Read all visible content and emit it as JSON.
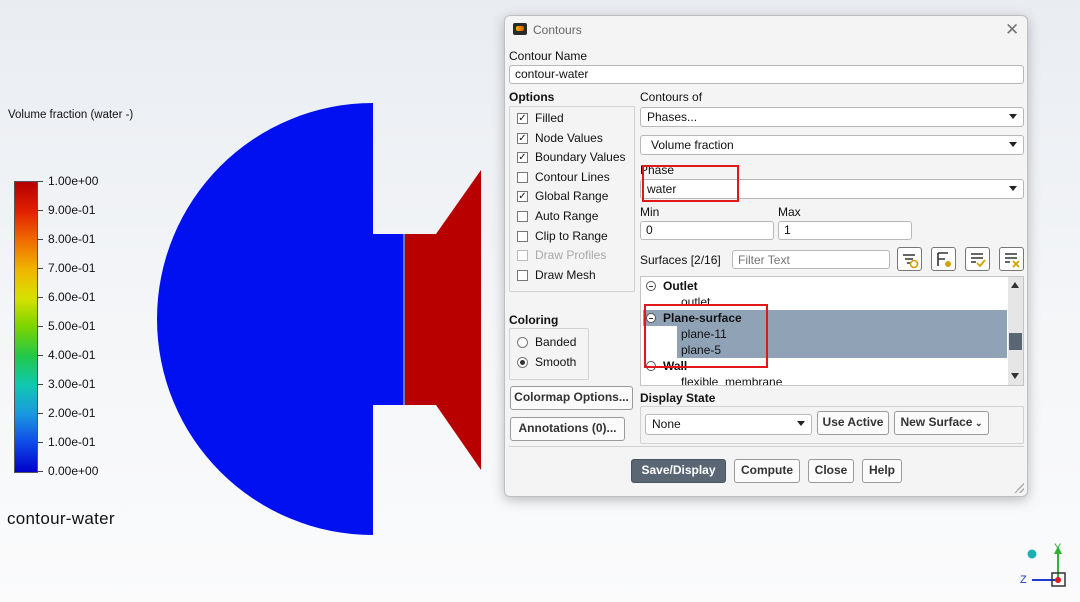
{
  "viewport": {
    "legend_title": "Volume fraction (water -)",
    "legend_ticks": [
      "1.00e+00",
      "9.00e-01",
      "8.00e-01",
      "7.00e-01",
      "6.00e-01",
      "5.00e-01",
      "4.00e-01",
      "3.00e-01",
      "2.00e-01",
      "1.00e-01",
      "0.00e+00"
    ],
    "contour_label": "contour-water",
    "colors": {
      "low": "#0000c8",
      "high": "#b40000"
    },
    "axis_triad": {
      "y": "Y",
      "z": "Z"
    }
  },
  "dialog": {
    "title": "Contours",
    "contour_name_label": "Contour Name",
    "contour_name_value": "contour-water",
    "options_label": "Options",
    "options": [
      {
        "label": "Filled",
        "checked": true,
        "enabled": true
      },
      {
        "label": "Node Values",
        "checked": true,
        "enabled": true
      },
      {
        "label": "Boundary Values",
        "checked": true,
        "enabled": true
      },
      {
        "label": "Contour Lines",
        "checked": false,
        "enabled": true
      },
      {
        "label": "Global Range",
        "checked": true,
        "enabled": true
      },
      {
        "label": "Auto Range",
        "checked": false,
        "enabled": true
      },
      {
        "label": "Clip to Range",
        "checked": false,
        "enabled": true
      },
      {
        "label": "Draw Profiles",
        "checked": false,
        "enabled": false
      },
      {
        "label": "Draw Mesh",
        "checked": false,
        "enabled": true
      }
    ],
    "contours_of_label": "Contours of",
    "contours_of_category": "Phases...",
    "contours_of_quantity": "Volume fraction",
    "phase_label": "Phase",
    "phase_value": "water",
    "min_label": "Min",
    "min_value": "0",
    "max_label": "Max",
    "max_value": "1",
    "surfaces_label": "Surfaces [2/16]",
    "filter_placeholder": "Filter Text",
    "surfaces": [
      {
        "label": "Outlet",
        "type": "group"
      },
      {
        "label": "outlet",
        "type": "item",
        "selected": false
      },
      {
        "label": "Plane-surface",
        "type": "group",
        "selected": true
      },
      {
        "label": "plane-11",
        "type": "item",
        "selected": true
      },
      {
        "label": "plane-5",
        "type": "item",
        "selected": true
      },
      {
        "label": "Wall",
        "type": "group"
      },
      {
        "label": "flexible_membrane",
        "type": "item",
        "selected": false
      }
    ],
    "coloring_label": "Coloring",
    "coloring_options": [
      {
        "label": "Banded",
        "selected": false
      },
      {
        "label": "Smooth",
        "selected": true
      }
    ],
    "colormap_button": "Colormap Options...",
    "annotations_button": "Annotations (0)...",
    "display_state_label": "Display State",
    "display_state_value": "None",
    "use_active_button": "Use Active",
    "new_surface_button": "New Surface",
    "save_display_button": "Save/Display",
    "compute_button": "Compute",
    "close_button": "Close",
    "help_button": "Help"
  }
}
